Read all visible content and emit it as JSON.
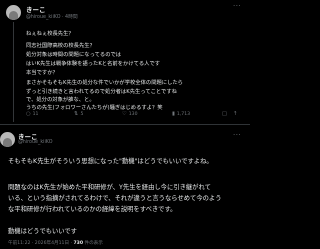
{
  "tweet1": {
    "name": "きーこ",
    "handle": "@hiroue_kiiKO · 4時間",
    "lines": [
      "ねぇねぇ校長先生？",
      "同志社国際高校の校長先生？",
      "処分対象は時間の問題になってるのでは",
      "はいK先生は戦争体験を語ったKと名前をかけてる人です",
      "本当ですか？",
      "まさかそもそもK先生の処分な件でいかが学校全体の問題にしたら",
      "ずっと引き続きと言われてるので処分者はK先生ってことですね",
      "で、処分の対象が誰な、と。",
      "うちの先生(フォロワーさんたちが)騒ぎはじめるすよ？笑"
    ],
    "actions": {
      "reply": "11",
      "retweet": "5",
      "like": "130",
      "views": "1,713"
    }
  },
  "tweet2": {
    "name": "きーこ",
    "handle": "@hiroue_kiiKO",
    "lines": [
      "そもそもK先生がそういう思想になった\"動機\"はどうでもいいですよね。",
      "問題なのはK先生が始めた平和研修が、Y先生を経由し今に引き継がれて",
      "いる、という指摘がされてるわけで、それが違うと言うならせめて今のよう",
      "な平和研修が行われているのかの経緯を説明をすべきです。",
      "動機はどうでもいいです"
    ]
  },
  "meta": {
    "time": "午前11:22 · 2026年4月11日 · ",
    "views_count": "730",
    "views_label": " 件の表示"
  }
}
